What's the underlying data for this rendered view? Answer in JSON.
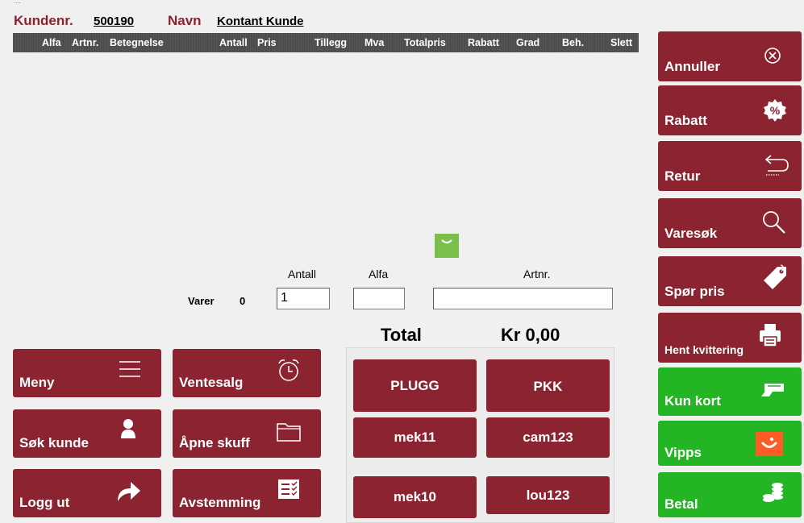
{
  "app": {
    "tiny_title": "...."
  },
  "header": {
    "customer_no_label": "Kundenr.",
    "customer_no_value": "500190",
    "name_label": "Navn",
    "name_value": "Kontant Kunde"
  },
  "columns": [
    "Alfa",
    "Artnr.",
    "Betegnelse",
    "Antall",
    "Pris",
    "Tillegg",
    "Mva",
    "Totalpris",
    "Rabatt",
    "Grad",
    "Beh.",
    "Slett"
  ],
  "entry": {
    "varer_label": "Varer",
    "varer_count": "0",
    "antall_label": "Antall",
    "antall_value": "1",
    "alfa_label": "Alfa",
    "alfa_value": "",
    "artnr_label": "Artnr.",
    "artnr_value": ""
  },
  "total": {
    "label": "Total",
    "amount": "Kr 0,00"
  },
  "left_buttons": [
    {
      "label": "Meny",
      "icon": "menu-icon"
    },
    {
      "label": "Ventesalg",
      "icon": "alarm-clock-icon"
    },
    {
      "label": "Søk kunde",
      "icon": "person-icon"
    },
    {
      "label": "Åpne skuff",
      "icon": "folder-icon"
    },
    {
      "label": "Logg ut",
      "icon": "share-arrow-icon"
    },
    {
      "label": "Avstemming",
      "icon": "checklist-icon"
    }
  ],
  "quick_buttons": [
    "PLUGG",
    "PKK",
    "mek11",
    "cam123",
    "mek10",
    "lou123"
  ],
  "right_buttons": [
    {
      "label": "Annuller",
      "icon": "cancel-circle-icon"
    },
    {
      "label": "Rabatt",
      "icon": "percent-badge-icon"
    },
    {
      "label": "Retur",
      "icon": "return-arrow-icon"
    },
    {
      "label": "Varesøk",
      "icon": "search-icon"
    },
    {
      "label": "Spør pris",
      "icon": "price-tag-icon"
    },
    {
      "label": "Hent kvittering",
      "icon": "printer-icon"
    },
    {
      "label": "Kun kort",
      "icon": "card-icon"
    },
    {
      "label": "Vipps",
      "icon": "vipps-logo-icon"
    },
    {
      "label": "Betal",
      "icon": "coins-icon"
    }
  ],
  "colors": {
    "button_red": "#8b2330",
    "button_green": "#23b523",
    "header_bar": "#4d4d4d",
    "indicator_green": "#7bc04a",
    "vipps_orange": "#ff5b24"
  }
}
